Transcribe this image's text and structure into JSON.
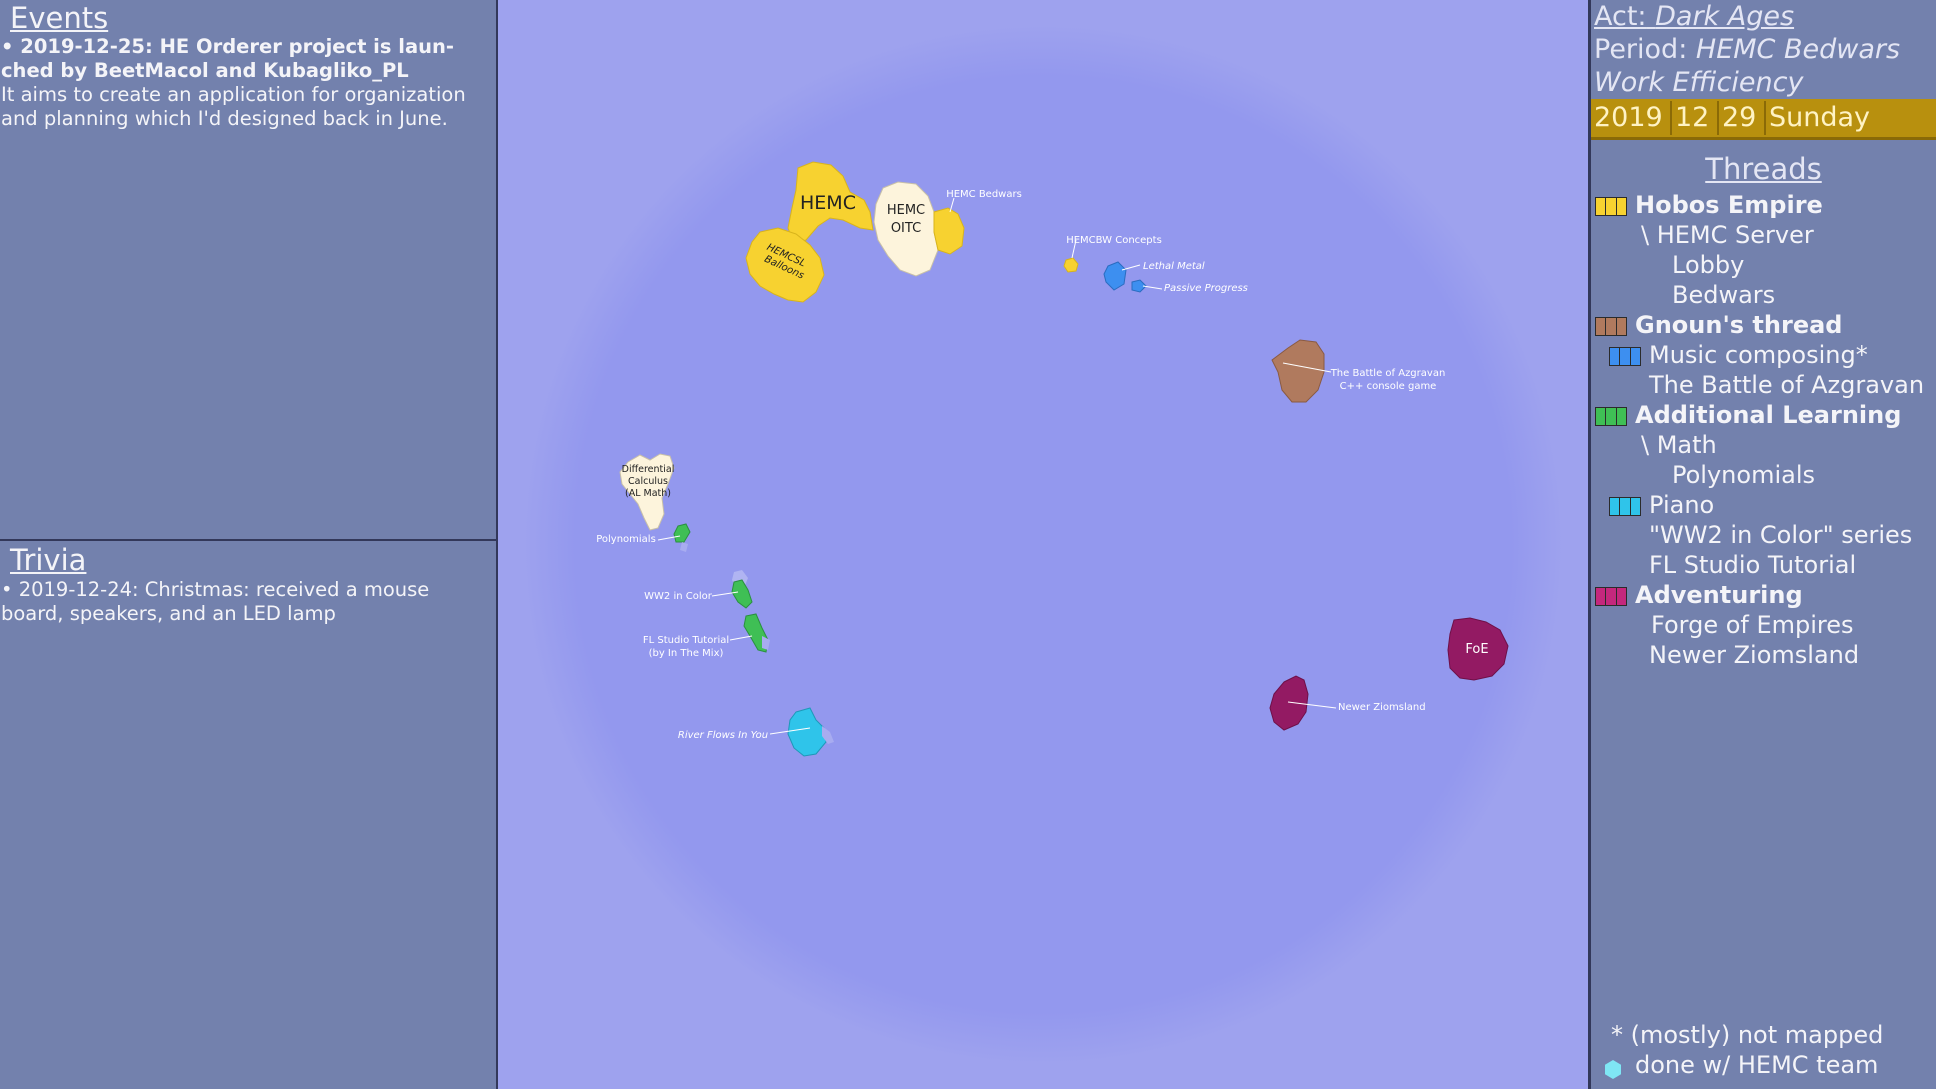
{
  "events": {
    "title": "Events",
    "items": [
      {
        "head": "• 2019-12-25: HE Orderer project is laun-ched by BeetMacol and Kubagliko_PL",
        "body": "It aims to create an application for organization and planning which I'd designed back in June."
      }
    ]
  },
  "trivia": {
    "title": "Trivia",
    "items": [
      "• 2019-12-24: Christmas: received a mouse board, speakers, and an LED lamp"
    ]
  },
  "map": {
    "labels": {
      "hemc": "HEMC",
      "hemc_oitc_1": "HEMC",
      "hemc_oitc_2": "OITC",
      "hemcsl_1": "HEMCSL",
      "hemcsl_2": "Balloons",
      "hemc_bedwars": "HEMC Bedwars",
      "hemcbw_concepts": "HEMCBW Concepts",
      "lethal_metal": "Lethal Metal",
      "passive_progress": "Passive Progress",
      "azgravan_1": "The Battle of Azgravan",
      "azgravan_2": "C++ console game",
      "diffcalc_1": "Differential",
      "diffcalc_2": "Calculus",
      "diffcalc_3": "(AL Math)",
      "polynomials": "Polynomials",
      "ww2": "WW2 in Color",
      "fl_1": "FL Studio Tutorial",
      "fl_2": "(by In The Mix)",
      "river": "River Flows In You",
      "foe": "FoE",
      "newer_ziomsland": "Newer Ziomsland"
    }
  },
  "status": {
    "act_label": "Act:",
    "act_value": "Dark Ages",
    "period_label": "Period:",
    "period_value": "HEMC Bedwars",
    "efficiency": "Work Efficiency",
    "date": {
      "year": "2019",
      "month": "12",
      "day": "29",
      "weekday": "Sunday"
    }
  },
  "threads": {
    "title": "Threads",
    "items": [
      {
        "label": "Hobos Empire",
        "bold": true,
        "colors": [
          "#f7d230",
          "#f7d230",
          "#f7d230"
        ]
      },
      {
        "label": "\\ HEMC Server"
      },
      {
        "label": "Lobby"
      },
      {
        "label": "Bedwars"
      },
      {
        "label": "Gnoun's thread",
        "bold": true,
        "colors": [
          "#b07a5e",
          "#b07a5e",
          "#b07a5e"
        ]
      },
      {
        "label": "Music composing*",
        "colors": [
          "#3d8ff0",
          "#3d8ff0",
          "#3d8ff0"
        ]
      },
      {
        "label": "The Battle of Azgravan"
      },
      {
        "label": "Additional Learning",
        "bold": true,
        "colors": [
          "#3fbf55",
          "#3fbf55",
          "#3fbf55"
        ]
      },
      {
        "label": "\\ Math"
      },
      {
        "label": "Polynomials"
      },
      {
        "label": "Piano",
        "colors": [
          "#2fc4ea",
          "#2fc4ea",
          "#2fc4ea"
        ]
      },
      {
        "label": "\"WW2 in Color\" series"
      },
      {
        "label": "FL Studio Tutorial"
      },
      {
        "label": "Adventuring",
        "bold": true,
        "colors": [
          "#c4287d",
          "#c4287d",
          "#c4287d"
        ]
      },
      {
        "label": "Forge of Empires"
      },
      {
        "label": "Newer Ziomsland"
      }
    ]
  },
  "legend": {
    "note1": "* (mostly) not mapped",
    "note2": "done w/ HEMC team"
  },
  "colors": {
    "hobos": "#f7d230",
    "hemc_team": "#fdf4dc",
    "music": "#3d8ff0",
    "gnoun": "#b07a5e",
    "learning": "#3fbf55",
    "piano": "#2fc4ea",
    "adventuring": "#931a63",
    "map_bg": "#9398ee"
  }
}
